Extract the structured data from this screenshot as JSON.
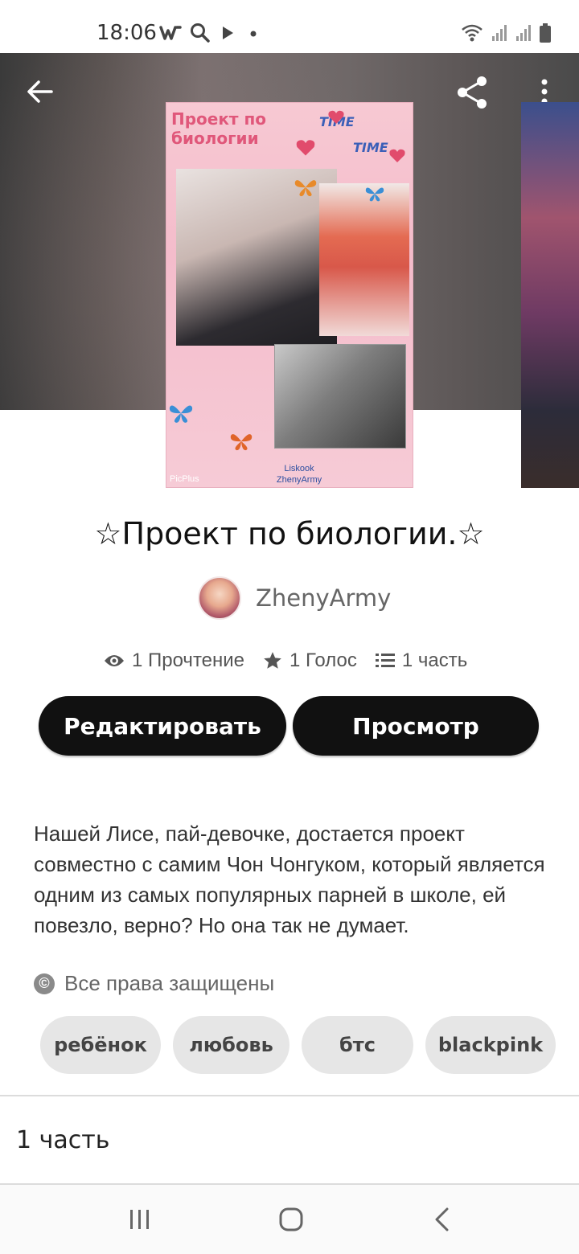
{
  "status_bar": {
    "time": "18:06",
    "left_icons": [
      "wattpad-icon",
      "search-icon",
      "play-icon",
      "dot-icon"
    ],
    "right_icons": [
      "wifi-icon",
      "signal-icon",
      "signal-icon-2",
      "battery-icon"
    ]
  },
  "header": {
    "back_icon": "arrow-left-icon",
    "share_icon": "share-icon",
    "more_icon": "more-vertical-icon"
  },
  "cover": {
    "title_line1": "Проект по",
    "title_line2": "биологии",
    "time_1": "TIME",
    "time_2": "TIME",
    "credit_line1": "Liskook",
    "credit_line2": "ZhenyArmy",
    "watermark": "PicPlus"
  },
  "story": {
    "title": "☆Проект по биологии.☆",
    "author": "ZhenyArmy"
  },
  "stats": {
    "reads": "1 Прочтение",
    "votes": "1 Голос",
    "parts": "1 часть"
  },
  "actions": {
    "edit_label": "Редактировать",
    "view_label": "Просмотр"
  },
  "description": "Нашей Лисе, пай-девочке, достается проект совместно с самим Чон Чонгуком, который является одним из самых популярных парней в школе, ей повезло, верно? Но она так не думает.",
  "copyright": {
    "icon": "©",
    "text": "Все права защищены"
  },
  "tags": [
    "ребёнок",
    "любовь",
    "бтс",
    "blackpink"
  ],
  "parts_section": {
    "label": "1 часть"
  },
  "nav": [
    "recent-apps-icon",
    "home-icon",
    "back-icon"
  ]
}
